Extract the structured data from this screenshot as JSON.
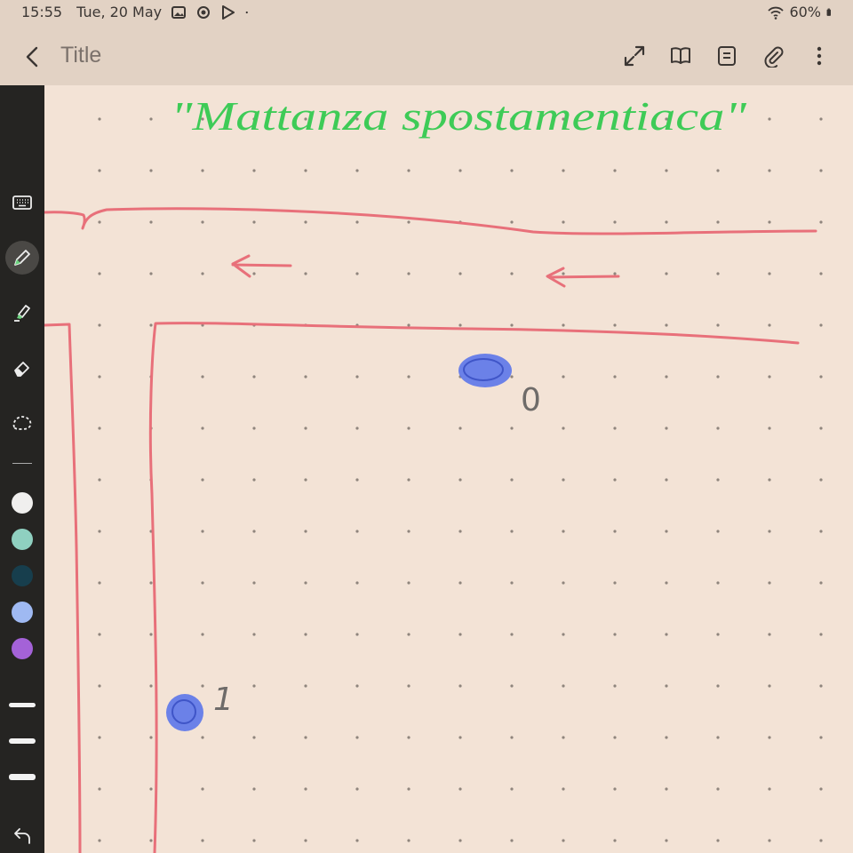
{
  "status": {
    "time": "15:55",
    "date": "Tue, 20 May",
    "battery": "60%",
    "icons": [
      "image-icon",
      "focus-icon",
      "play-store-icon",
      "dot-icon",
      "wifi-icon",
      "battery-icon"
    ]
  },
  "appbar": {
    "title": "Title",
    "actions": [
      "expand-icon",
      "reading-mode-icon",
      "page-options-icon",
      "attach-icon",
      "more-icon"
    ]
  },
  "toolbar": {
    "tools": [
      "keyboard-icon",
      "pen-icon",
      "highlighter-icon",
      "eraser-icon",
      "lasso-icon"
    ],
    "active_tool": "pen-icon",
    "colors": [
      "#f0efee",
      "#8fd0c0",
      "#173e4d",
      "#9fb9f2",
      "#a462d8"
    ],
    "stroke_sizes": [
      "thin",
      "medium",
      "thick"
    ]
  },
  "note": {
    "heading": "\"Mattanza spostamentiaca\"",
    "heading_color": "#3ecb57",
    "road_color": "#e8707a",
    "dot_color": "#5c76ea",
    "label_color": "#6e6b69",
    "labels": [
      "0",
      "1"
    ]
  }
}
